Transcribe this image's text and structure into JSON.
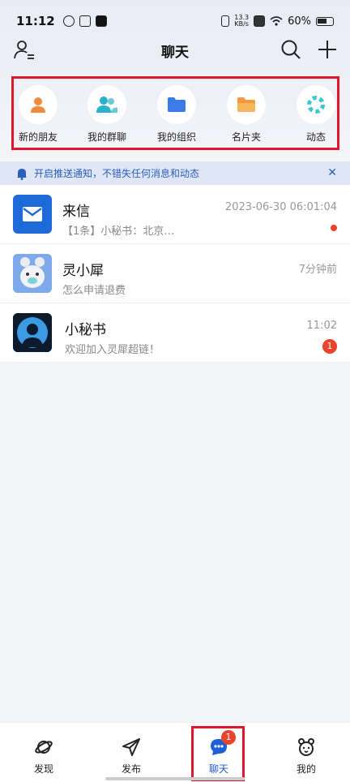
{
  "status_bar": {
    "time": "11:12",
    "net_speed_top": "13.3",
    "net_speed_bottom": "KB/s",
    "battery": "60%"
  },
  "nav": {
    "title": "聊天"
  },
  "quick_actions": [
    {
      "label": "新的朋友",
      "icon": "person-icon",
      "color": "#f08a3c"
    },
    {
      "label": "我的群聊",
      "icon": "group-icon",
      "color": "#2bb1c9"
    },
    {
      "label": "我的组织",
      "icon": "folder-icon",
      "color": "#3a7be8"
    },
    {
      "label": "名片夹",
      "icon": "folder-icon",
      "color": "#f39a3f"
    },
    {
      "label": "动态",
      "icon": "ring-icon",
      "color": "#3cc6d0"
    }
  ],
  "notice": {
    "text": "开启推送通知，不错失任何消息和动态"
  },
  "chats": [
    {
      "name": "来信",
      "preview": "【1条】小秘书：北京…",
      "time": "2023-06-30 06:01:04",
      "unread_dot": true
    },
    {
      "name": "灵小犀",
      "preview": "怎么申请退费",
      "time": "7分钟前"
    },
    {
      "name": "小秘书",
      "preview": "欢迎加入灵犀超链！",
      "time": "11:02",
      "badge": "1"
    }
  ],
  "tabs": [
    {
      "label": "发现",
      "icon": "planet-icon"
    },
    {
      "label": "发布",
      "icon": "send-icon"
    },
    {
      "label": "聊天",
      "icon": "chat-icon",
      "badge": "1",
      "active": true
    },
    {
      "label": "我的",
      "icon": "bear-icon"
    }
  ],
  "colors": {
    "accent": "#1f5fd6",
    "highlight_box": "#e0162b",
    "badge": "#e8442b"
  }
}
